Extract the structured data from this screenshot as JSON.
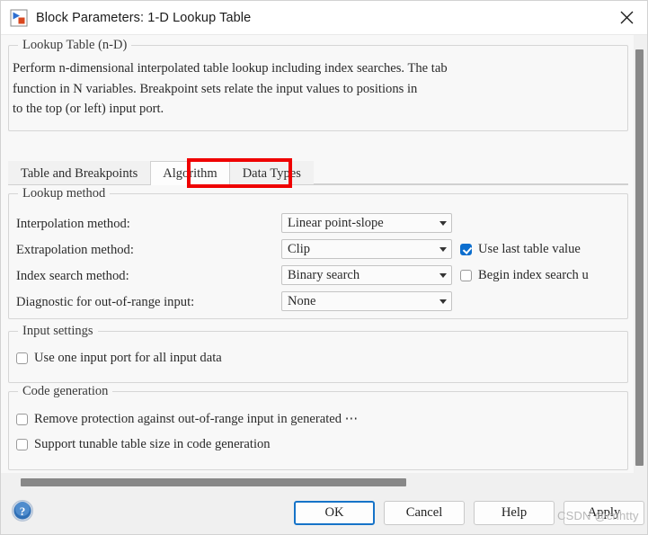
{
  "window": {
    "title": "Block Parameters: 1-D Lookup Table",
    "app_icon": "simulink-block-icon",
    "close_icon": "close-icon"
  },
  "description_group": {
    "legend": "Lookup Table (n-D)",
    "text": "Perform n-dimensional interpolated table lookup including index searches. The tab\nfunction in N variables. Breakpoint sets relate the input values to positions in\nto the top (or left) input port."
  },
  "tabs": [
    {
      "label": "Table and Breakpoints",
      "active": false
    },
    {
      "label": "Algorithm",
      "active": true
    },
    {
      "label": "Data Types",
      "active": false
    }
  ],
  "annotation": {
    "name": "red-highlight-box",
    "color": "#ef0000"
  },
  "lookup_method": {
    "legend": "Lookup method",
    "interpolation": {
      "label": "Interpolation method:",
      "value": "Linear point-slope"
    },
    "extrapolation": {
      "label": "Extrapolation method:",
      "value": "Clip",
      "checkbox": {
        "label": "Use last table value",
        "checked": true
      }
    },
    "index_search": {
      "label": "Index search method:",
      "value": "Binary search",
      "checkbox": {
        "label": "Begin index search u",
        "checked": false
      }
    },
    "diagnostic": {
      "label": "Diagnostic for out-of-range input:",
      "value": "None"
    }
  },
  "input_settings": {
    "legend": "Input settings",
    "checkbox": {
      "label": "Use one input port for all input data",
      "checked": false
    }
  },
  "code_generation": {
    "legend": "Code generation",
    "checkboxes": [
      {
        "label": "Remove protection against out-of-range input in generated ⋯",
        "checked": false
      },
      {
        "label": "Support tunable table size in code generation",
        "checked": false
      }
    ]
  },
  "buttons": {
    "help_icon": "help-circle-icon",
    "ok": "OK",
    "cancel": "Cancel",
    "help": "Help",
    "apply": "Apply"
  },
  "scrollbars": {
    "vertical": "vertical-scrollbar",
    "horizontal": "horizontal-scrollbar"
  },
  "watermark": "CSDN @cnhtty"
}
